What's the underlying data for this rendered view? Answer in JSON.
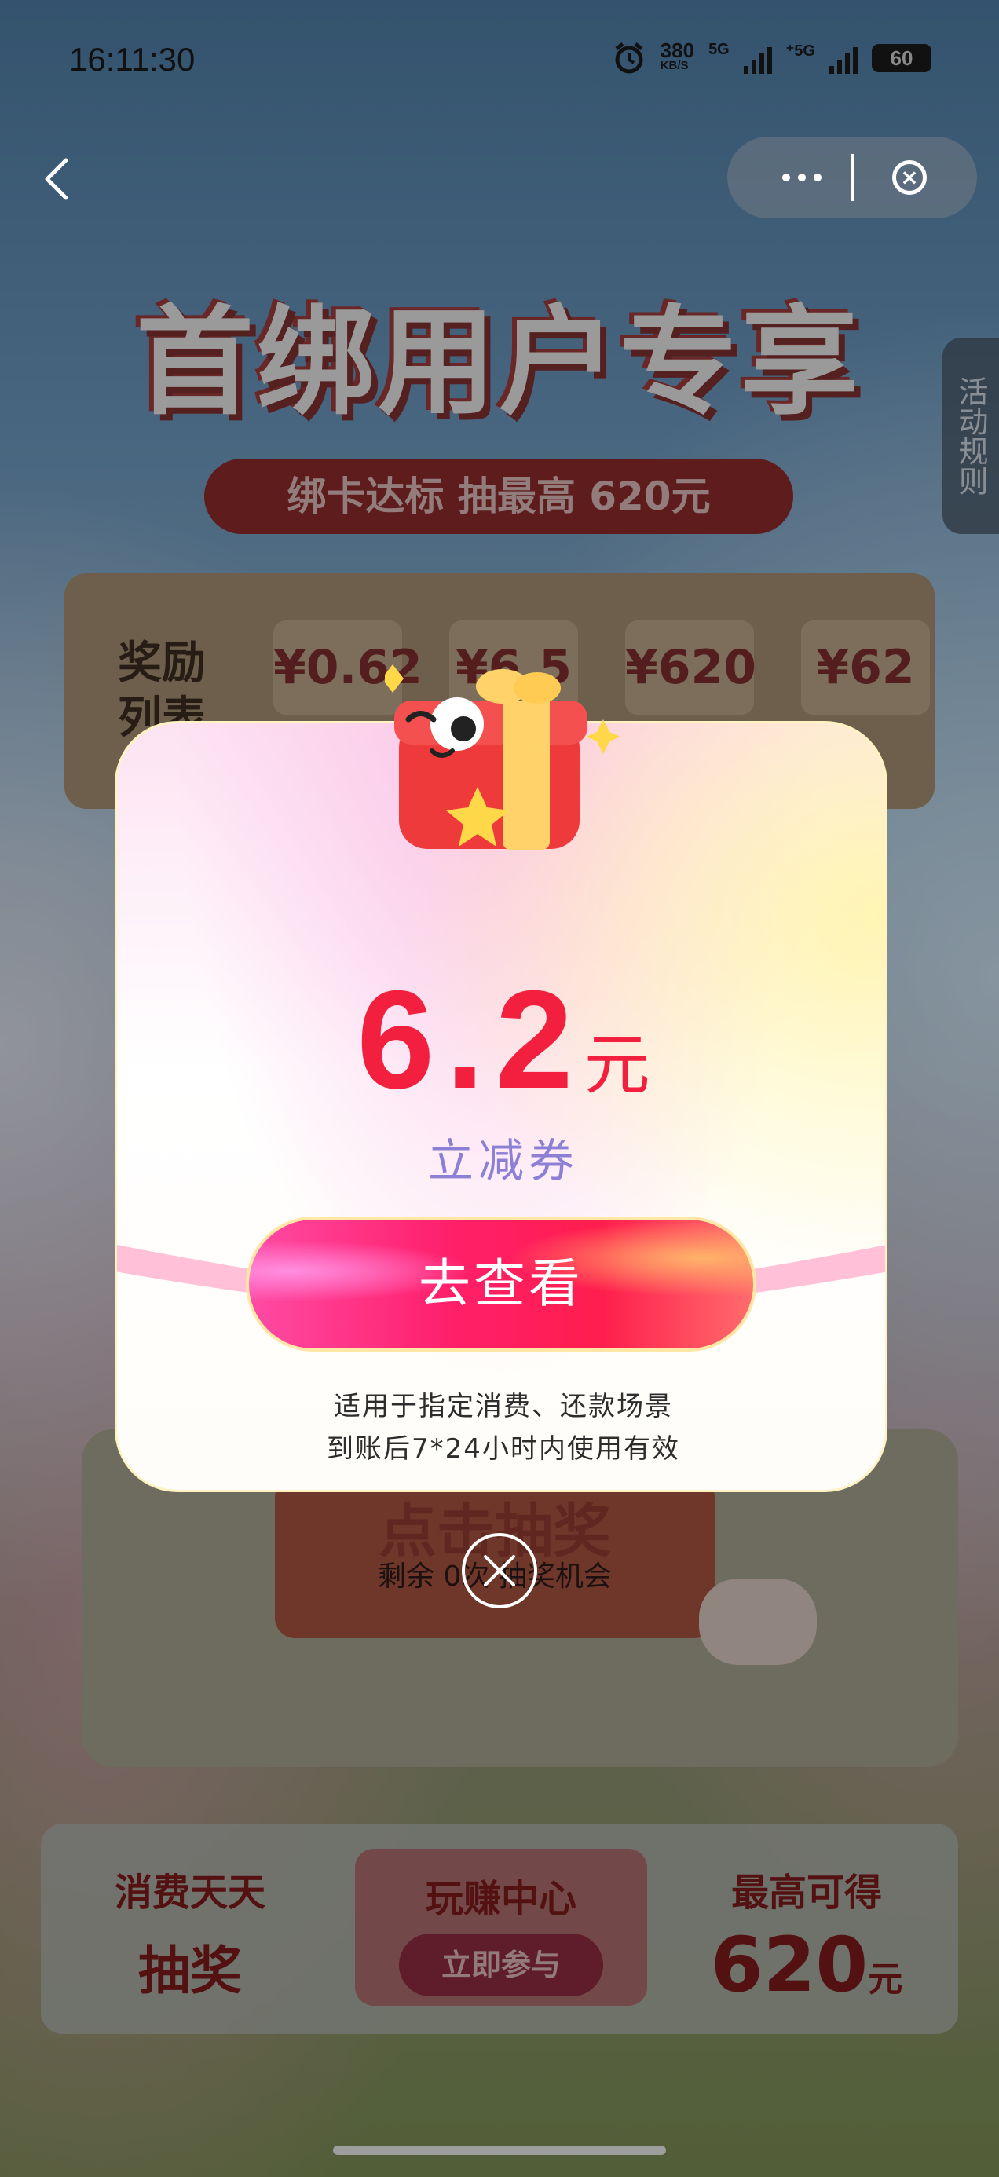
{
  "status_bar": {
    "time": "16:11:30",
    "speed_value": "380",
    "speed_unit": "KB/S",
    "net1": "5G",
    "net2": "⁺5G",
    "battery": "60"
  },
  "nav": {
    "back": "back-icon",
    "more": "more-icon",
    "close": "close-icon"
  },
  "background": {
    "title": "首绑用户专享",
    "subtitle": "绑卡达标 抽最高 620元",
    "rules_tab": "活动规则",
    "reward_title": "奖励列表",
    "reward_chips": [
      "¥0.62",
      "¥6.5",
      "¥620",
      "¥62"
    ],
    "draw_label": "点击抽奖",
    "remaining": "剩余 0次 抽奖机会",
    "bottom": {
      "left_a": "消费天天",
      "left_b": "抽奖",
      "mid_title": "玩赚中心",
      "mid_button": "立即参与",
      "right_a": "最高可得",
      "right_b": "620",
      "right_unit": "元"
    }
  },
  "modal": {
    "amount": "6.2",
    "unit": "元",
    "coupon_type": "立减券",
    "button": "去查看",
    "note_line1": "适用于指定消费、还款场景",
    "note_line2": "到账后7*24小时内使用有效"
  },
  "colors": {
    "amount_red": "#f2203e",
    "coupon_purple": "#8c7fd6",
    "button_pink": "#ff1f6a"
  }
}
